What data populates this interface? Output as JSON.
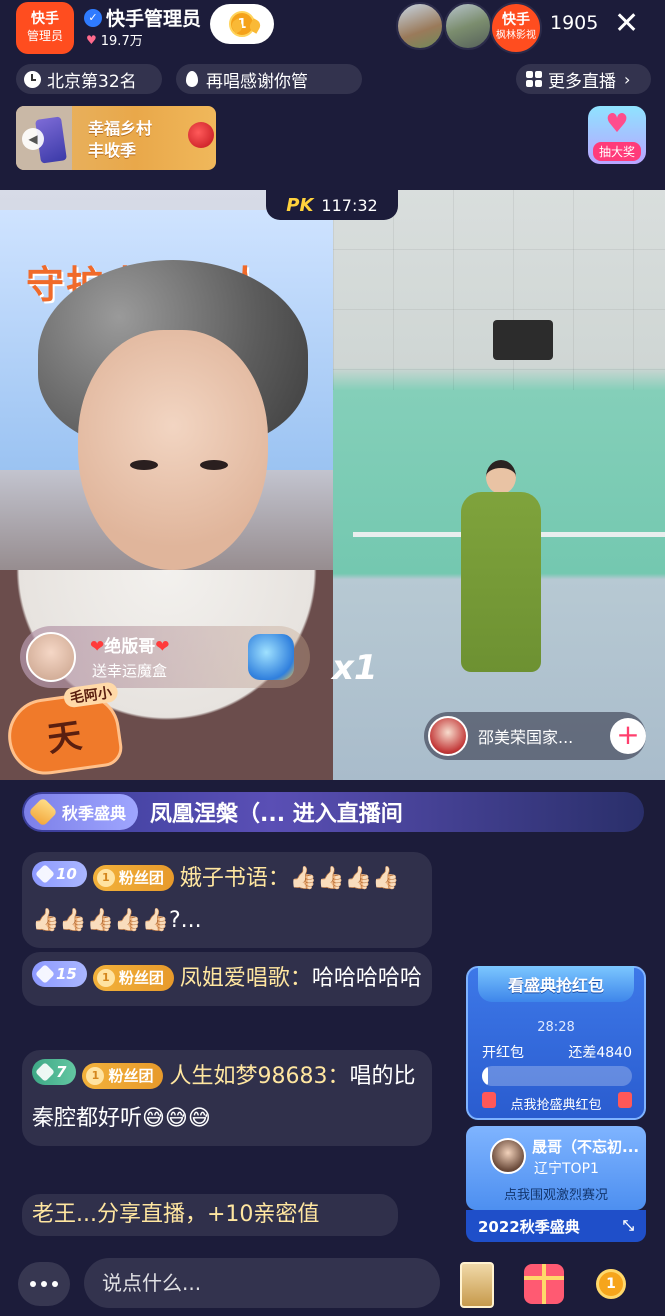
{
  "header": {
    "host_logo_line1": "快手",
    "host_logo_line2": "管理员",
    "host_name": "快手管理员",
    "host_likes": "19.7万",
    "rank_badge": "1",
    "viewer_badge_line1": "快手",
    "viewer_badge_line2": "枫林影视",
    "viewer_count": "1905",
    "close_symbol": "✕"
  },
  "subbar": {
    "region_rank": "北京第32名",
    "scroll_message": "再唱感谢你管",
    "more_live": "更多直播"
  },
  "banner": {
    "line1": "幸福乡村",
    "line2": "丰收季"
  },
  "lottery": {
    "label": "抽大奖"
  },
  "pk": {
    "logo": "PK",
    "timer": "117:32"
  },
  "video_left": {
    "sign_text": "守护中老年人",
    "badge_text": "天",
    "badge_small": "毛阿小"
  },
  "gift": {
    "user": "绝版哥",
    "desc": "送幸运魔盒",
    "count": "x1"
  },
  "opponent": {
    "name": "邵美荣国家..."
  },
  "enter_banner": {
    "tag": "秋季盛典",
    "text": "凤凰涅槃（... 进入直播间"
  },
  "comments": [
    {
      "level": "10",
      "fan": "粉丝团",
      "fan_level": "1",
      "user": "娥子书语：",
      "text": "👍🏻👍🏻👍🏻👍🏻👍🏻👍🏻👍🏻👍🏻👍🏻?..."
    },
    {
      "level": "15",
      "fan": "粉丝团",
      "fan_level": "1",
      "user": "凤姐爱唱歌：",
      "text": "哈哈哈哈哈"
    },
    {
      "level": "7",
      "fan": "粉丝团",
      "fan_level": "1",
      "user": "人生如梦98683：",
      "text": "唱的比秦腔都好听😅😅😅"
    },
    {
      "text": "老王...分享直播，+10亲密值"
    }
  ],
  "red_packet": {
    "title": "看盛典抢红包",
    "timer": "28:28",
    "label_left": "开红包",
    "label_right": "还差4840",
    "progress": 0.04,
    "cta": "点我抢盛典红包"
  },
  "rank_card": {
    "name": "晟哥（不忘初...",
    "sub": "辽宁TOP1",
    "cta": "点我围观激烈赛况"
  },
  "event_bar": {
    "label": "2022秋季盛典"
  },
  "bottom": {
    "input_placeholder": "说点什么...",
    "rank_coin": "1"
  },
  "colors": {
    "background": "#1c1c3a",
    "brand_orange": "#ff4d1f",
    "fan_gold": "#f2b13b",
    "level_blue": "#8d99ff",
    "level_green": "#3ea886"
  }
}
